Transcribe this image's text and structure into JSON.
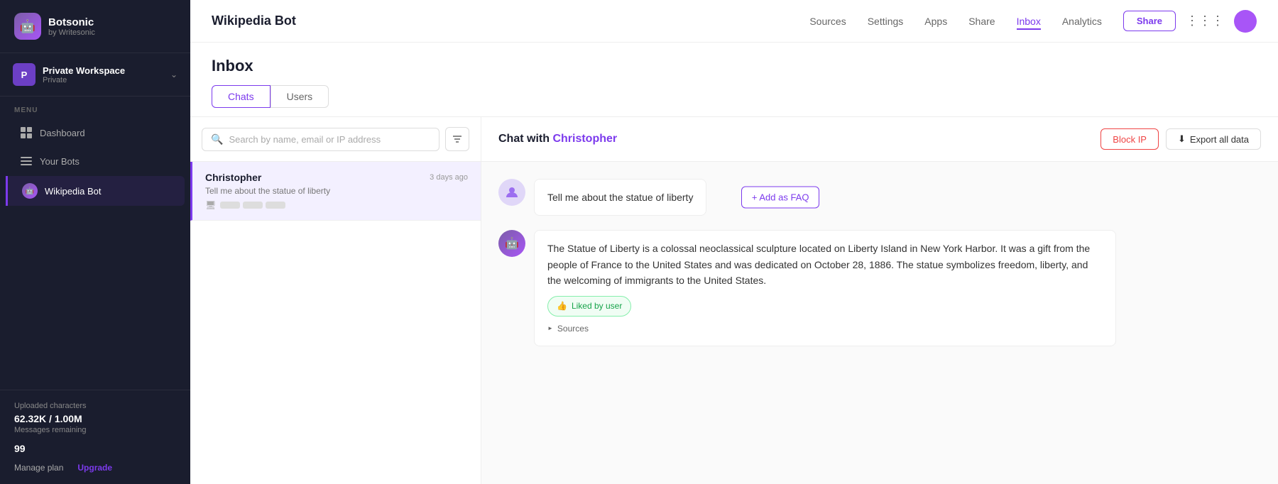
{
  "app": {
    "name": "Botsonic",
    "subtitle": "by Writesonic"
  },
  "workspace": {
    "avatar_letter": "P",
    "name": "Private Workspace",
    "type": "Private"
  },
  "menu_label": "MENU",
  "nav": [
    {
      "id": "dashboard",
      "label": "Dashboard",
      "icon": "⊞",
      "active": false
    },
    {
      "id": "your-bots",
      "label": "Your Bots",
      "icon": "☰",
      "active": false
    },
    {
      "id": "wikipedia-bot",
      "label": "Wikipedia Bot",
      "icon": "🤖",
      "active": true,
      "is_bot": true
    }
  ],
  "sidebar_footer": {
    "uploaded_label": "Uploaded characters",
    "uploaded_value": "62.32K / 1.00M",
    "messages_label": "Messages remaining",
    "messages_count": "99",
    "manage_label": "Manage plan",
    "upgrade_label": "Upgrade"
  },
  "top_nav": {
    "bot_title": "Wikipedia Bot",
    "links": [
      {
        "id": "sources",
        "label": "Sources",
        "active": false
      },
      {
        "id": "settings",
        "label": "Settings",
        "active": false
      },
      {
        "id": "apps",
        "label": "Apps",
        "active": false
      },
      {
        "id": "share",
        "label": "Share",
        "active": false
      },
      {
        "id": "inbox",
        "label": "Inbox",
        "active": true
      },
      {
        "id": "analytics",
        "label": "Analytics",
        "active": false
      }
    ],
    "share_btn": "Share"
  },
  "inbox": {
    "title": "Inbox",
    "tabs": [
      {
        "id": "chats",
        "label": "Chats",
        "active": true
      },
      {
        "id": "users",
        "label": "Users",
        "active": false
      }
    ],
    "search_placeholder": "Search by name, email or IP address",
    "chats": [
      {
        "id": "christopher",
        "name": "Christopher",
        "preview": "Tell me about the statue of liberty",
        "time": "3 days ago",
        "active": true
      }
    ],
    "chat_panel": {
      "title": "Chat with",
      "user_name": "Christopher",
      "block_ip_label": "Block IP",
      "export_label": "Export all data",
      "messages": [
        {
          "id": "msg1",
          "type": "user",
          "text": "Tell me about the statue of liberty"
        },
        {
          "id": "msg2",
          "type": "bot",
          "text": "The Statue of Liberty is a colossal neoclassical sculpture located on Liberty Island in New York Harbor. It was a gift from the people of France to the United States and was dedicated on October 28, 1886. The statue symbolizes freedom, liberty, and the welcoming of immigrants to the United States.",
          "liked": true,
          "liked_label": "Liked by user",
          "sources_label": "Sources"
        }
      ],
      "add_faq_label": "+ Add as FAQ"
    }
  }
}
